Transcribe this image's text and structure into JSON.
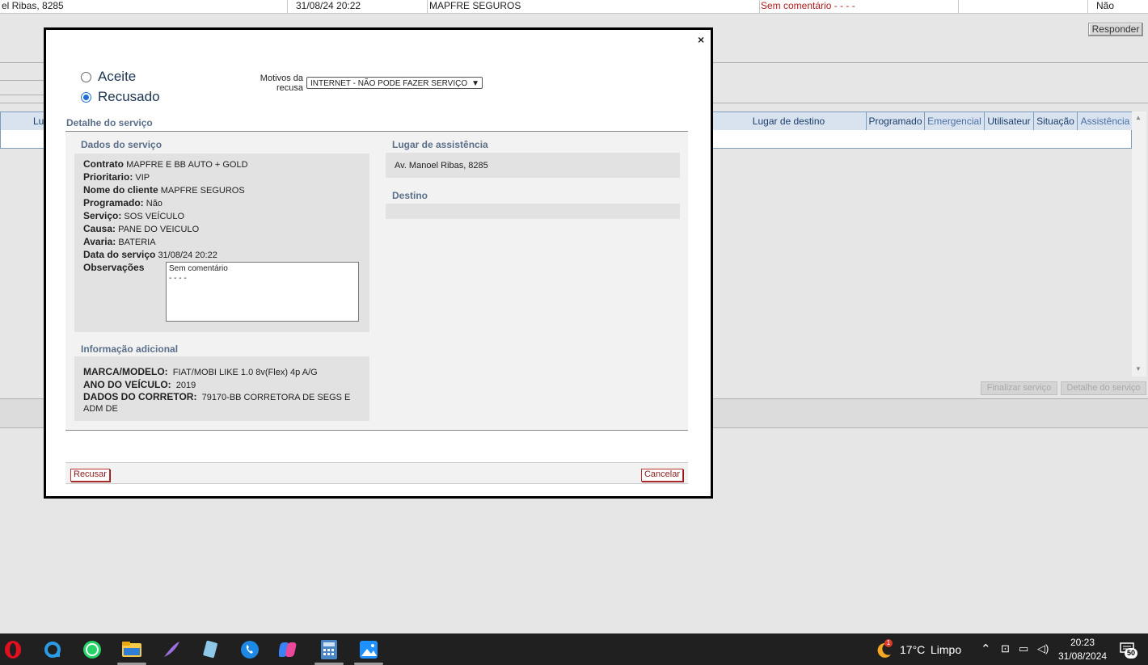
{
  "background": {
    "top_row": {
      "address": "el Ribas, 8285",
      "datetime": "31/08/24 20:22",
      "client": "MAPFRE SEGUROS",
      "comment": "Sem comentário - - - -",
      "flag": "Não"
    },
    "responder_label": "Responder",
    "grid_headers": {
      "lugar": "Lug",
      "lugar_destino": "Lugar de destino",
      "programado": "Programado",
      "emergencial": "Emergencial",
      "utilisateur": "Utilisateur",
      "situacao": "Situação",
      "assistencia": "Assistência"
    },
    "finalizar_label": "Finalizar serviço",
    "detalhe_label": "Detalhe do serviço"
  },
  "modal": {
    "close_label": "×",
    "options": {
      "aceite": "Aceite",
      "recusado": "Recusado",
      "selected": "recusado"
    },
    "motivos_label": "Motivos da recusa",
    "motivo_value": "INTERNET - NÃO PODE FAZER SERVIÇO",
    "detalhe_title": "Detalhe do serviço",
    "dados": {
      "title": "Dados do serviço",
      "contrato_k": "Contrato",
      "contrato_v": "MAPFRE E BB AUTO + GOLD",
      "prioritario_k": "Prioritario:",
      "prioritario_v": "VIP",
      "cliente_k": "Nome do cliente",
      "cliente_v": "MAPFRE SEGUROS",
      "programado_k": "Programado:",
      "programado_v": "Não",
      "servico_k": "Serviço:",
      "servico_v": "SOS VEÍCULO",
      "causa_k": "Causa:",
      "causa_v": "PANE DO VEICULO",
      "avaria_k": "Avaria:",
      "avaria_v": "BATERIA",
      "data_k": "Data do serviço",
      "data_v": "31/08/24 20:22",
      "obs_k": "Observações",
      "obs_line1": "Sem comentário",
      "obs_line2": "- - - -"
    },
    "info": {
      "title": "Informação adicional",
      "marca_k": "MARCA/MODELO:",
      "marca_v": "FIAT/MOBI LIKE 1.0 8v(Flex) 4p A/G",
      "ano_k": "ANO DO VEÍCULO:",
      "ano_v": "2019",
      "corretor_k": "DADOS DO CORRETOR:",
      "corretor_v": "79170-BB CORRETORA DE SEGS E ADM DE"
    },
    "lugar": {
      "title": "Lugar de assistência",
      "value": "Av. Manoel Ribas, 8285"
    },
    "destino": {
      "title": "Destino",
      "value": ""
    },
    "recusar_label": "Recusar",
    "cancelar_label": "Cancelar"
  },
  "taskbar": {
    "weather_badge": "1",
    "temperature": "17°C",
    "condition": "Limpo",
    "time": "20:23",
    "date": "31/08/2024",
    "notification_count": "50"
  }
}
